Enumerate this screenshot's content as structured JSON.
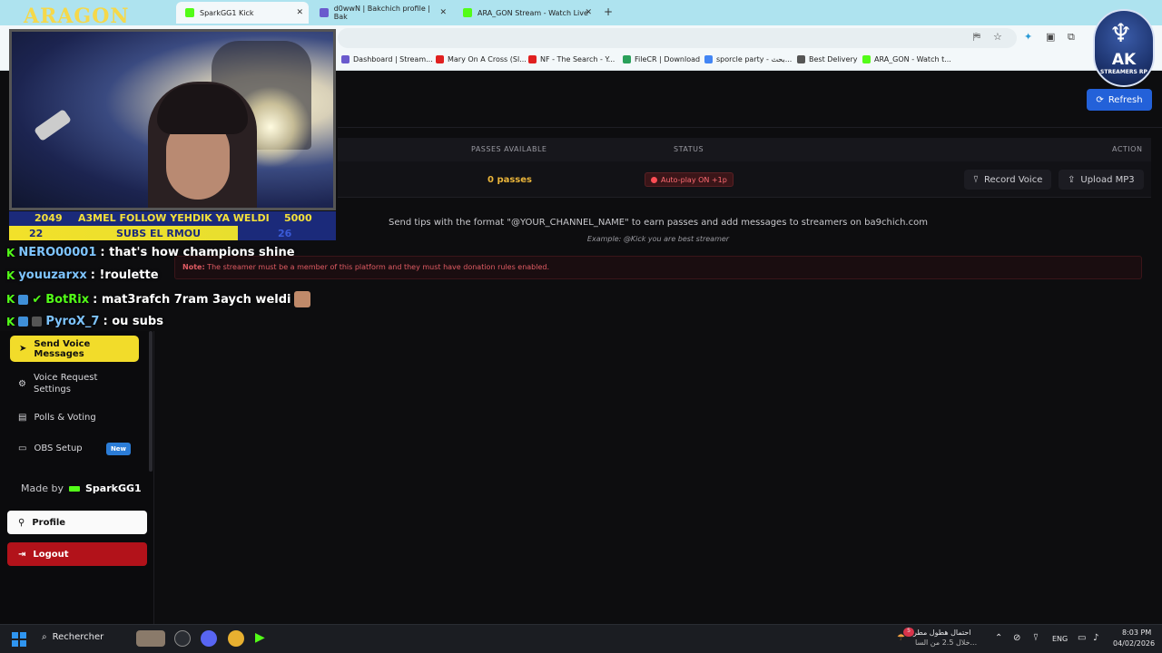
{
  "browser": {
    "tabs": [
      {
        "label": "SparkGG1 Kick",
        "active": true
      },
      {
        "label": "d0wwN | Bakchich profile | Bak",
        "active": false
      },
      {
        "label": "ARA_GON Stream - Watch Live",
        "active": false
      }
    ],
    "new_tab_symbol": "+",
    "bookmarks": [
      {
        "label": "Dashboard | Stream...",
        "color": "#6a5acd"
      },
      {
        "label": "Mary On A Cross (Sl...",
        "color": "#e02020"
      },
      {
        "label": "NF - The Search - Y...",
        "color": "#e02020"
      },
      {
        "label": "FileCR | Download",
        "color": "#2aa05a"
      },
      {
        "label": "sporcle party - بحث...",
        "color": "#4285f4"
      },
      {
        "label": "Best Delivery",
        "color": "#555555"
      },
      {
        "label": "ARA_GON - Watch t...",
        "color": "#53fc18"
      }
    ]
  },
  "stream_overlay": {
    "logo": "ARAGON",
    "goal_line1": {
      "left": "2049",
      "text": "A3MEL FOLLOW YEHDIK YA WELDI",
      "right": "5000"
    },
    "goal_line2": {
      "left": "22",
      "text": "SUBS EL RMOU",
      "right": "26"
    },
    "chat": [
      {
        "user": "NERO00001",
        "message": ": that's how champions shine"
      },
      {
        "user": "youuzarxx",
        "message": ": !roulette"
      },
      {
        "user": "BotRix",
        "message": ": mat3rafch 7ram 3aych weldi"
      },
      {
        "user": "PyroX_7",
        "message": ": ou subs"
      }
    ],
    "ak_badge": {
      "title": "AK",
      "subtitle": "STREAMERS RP"
    }
  },
  "page": {
    "refresh_label": "Refresh",
    "table": {
      "headers": [
        "PASSES AVAILABLE",
        "STATUS",
        "ACTION"
      ],
      "row": {
        "passes": "0 passes",
        "status": "Auto-play ON +1p",
        "actions": [
          "Record Voice",
          "Upload MP3"
        ]
      }
    },
    "info": "Send tips with the format \"@YOUR_CHANNEL_NAME\" to earn passes and add messages to streamers on ba9chich.com",
    "example": "Example: @Kick you are best streamer",
    "note_label": "Note:",
    "note_text": "The streamer must be a member of this platform and they must have donation rules enabled."
  },
  "sidebar": {
    "active_item": "Send Voice Messages",
    "items": [
      {
        "label": "Voice Request Settings"
      },
      {
        "label": "Polls & Voting"
      },
      {
        "label": "OBS Setup",
        "badge": "New"
      }
    ],
    "made_by_prefix": "Made by",
    "made_by_name": "SparkGG1",
    "profile_label": "Profile",
    "logout_label": "Logout"
  },
  "taskbar": {
    "search_label": "Rechercher",
    "weather_line1": "احتمال هطول مطر",
    "weather_line2": "خلال 2.5 من السا...",
    "weather_badge": "5",
    "language": "ENG",
    "time": "8:03 PM",
    "date": "04/02/2026"
  }
}
